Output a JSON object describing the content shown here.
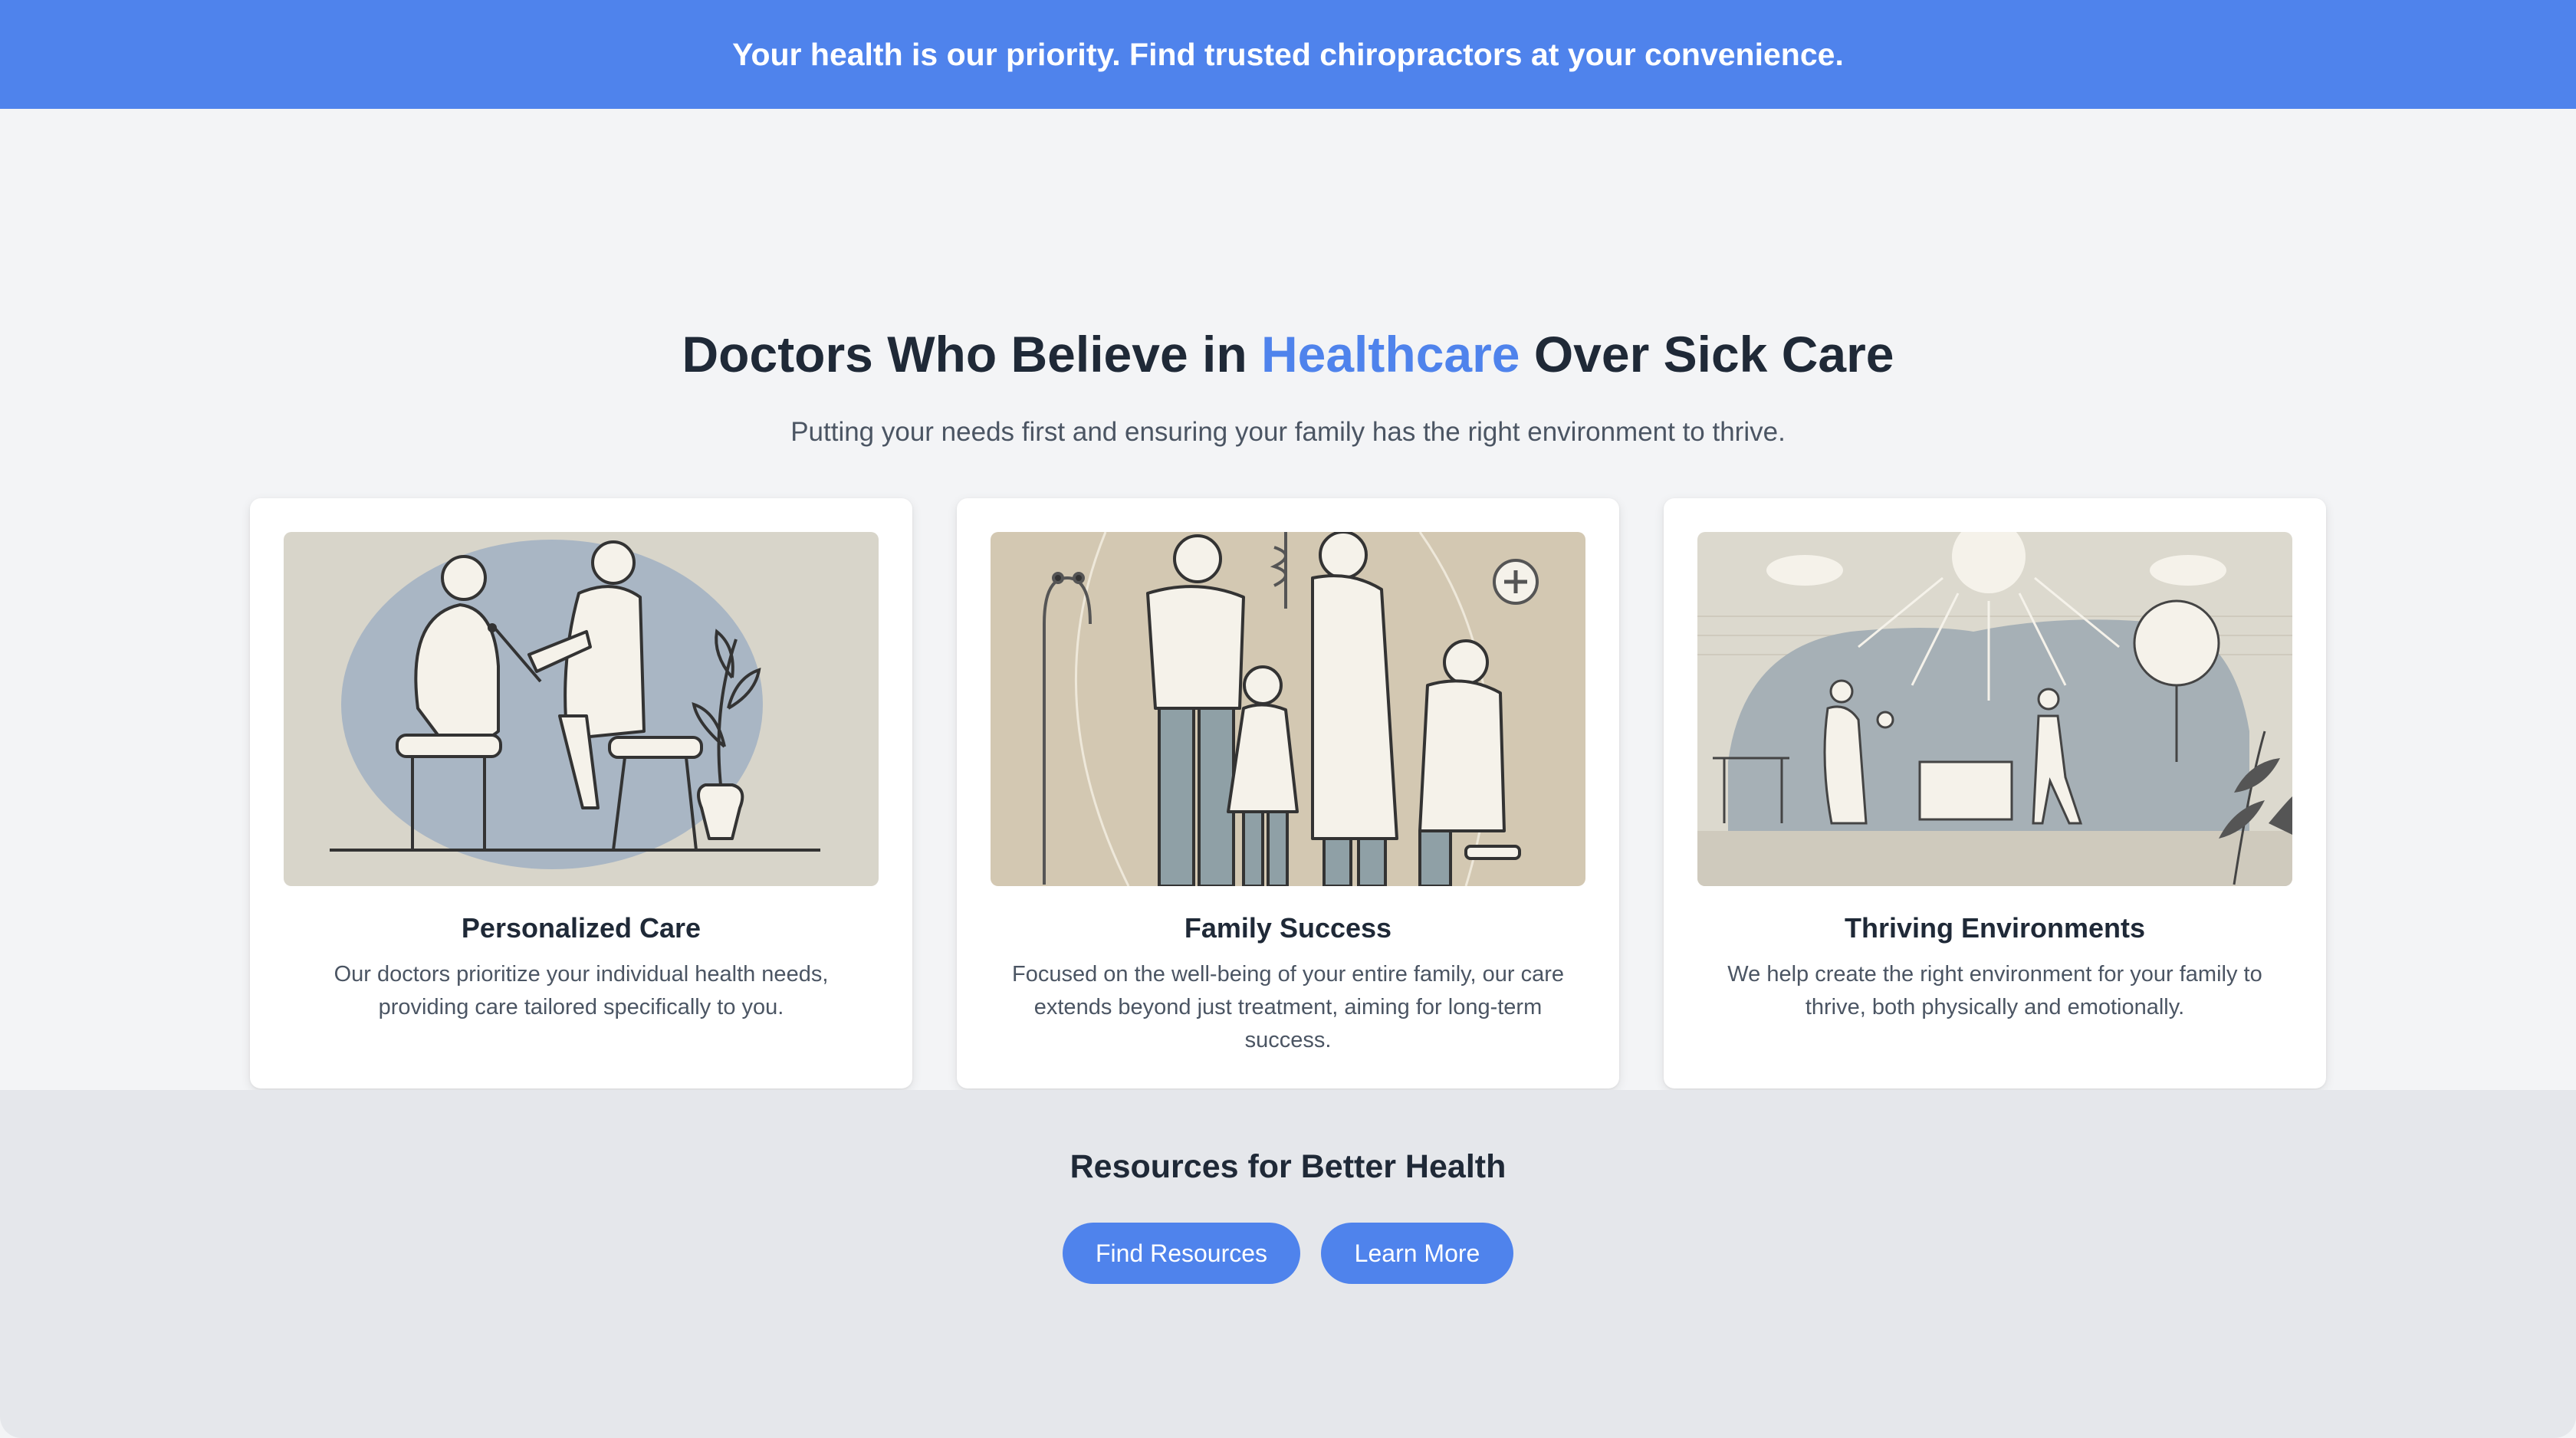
{
  "banner": {
    "text": "Your health is our priority. Find trusted chiropractors at your convenience."
  },
  "hero": {
    "title_before": "Doctors Who Believe in ",
    "title_accent": "Healthcare",
    "title_after": " Over Sick Care",
    "subtitle": "Putting your needs first and ensuring your family has the right environment to thrive."
  },
  "cards": [
    {
      "title": "Personalized Care",
      "text": "Our doctors prioritize your individual health needs, providing care tailored specifically to you.",
      "illustration": "doctor-examining-patient-illustration"
    },
    {
      "title": "Family Success",
      "text": "Focused on the well-being of your entire family, our care extends beyond just treatment, aiming for long-term success.",
      "illustration": "family-with-doctors-illustration"
    },
    {
      "title": "Thriving Environments",
      "text": "We help create the right environment for your family to thrive, both physically and emotionally.",
      "illustration": "sunny-outdoor-family-illustration"
    }
  ],
  "resources": {
    "title": "Resources for Better Health",
    "buttons": {
      "find": "Find Resources",
      "learn": "Learn More"
    }
  },
  "colors": {
    "accent": "#4f83ec",
    "background": "#f3f4f6",
    "footer_bg": "#e5e7eb",
    "text": "#1f2937"
  }
}
